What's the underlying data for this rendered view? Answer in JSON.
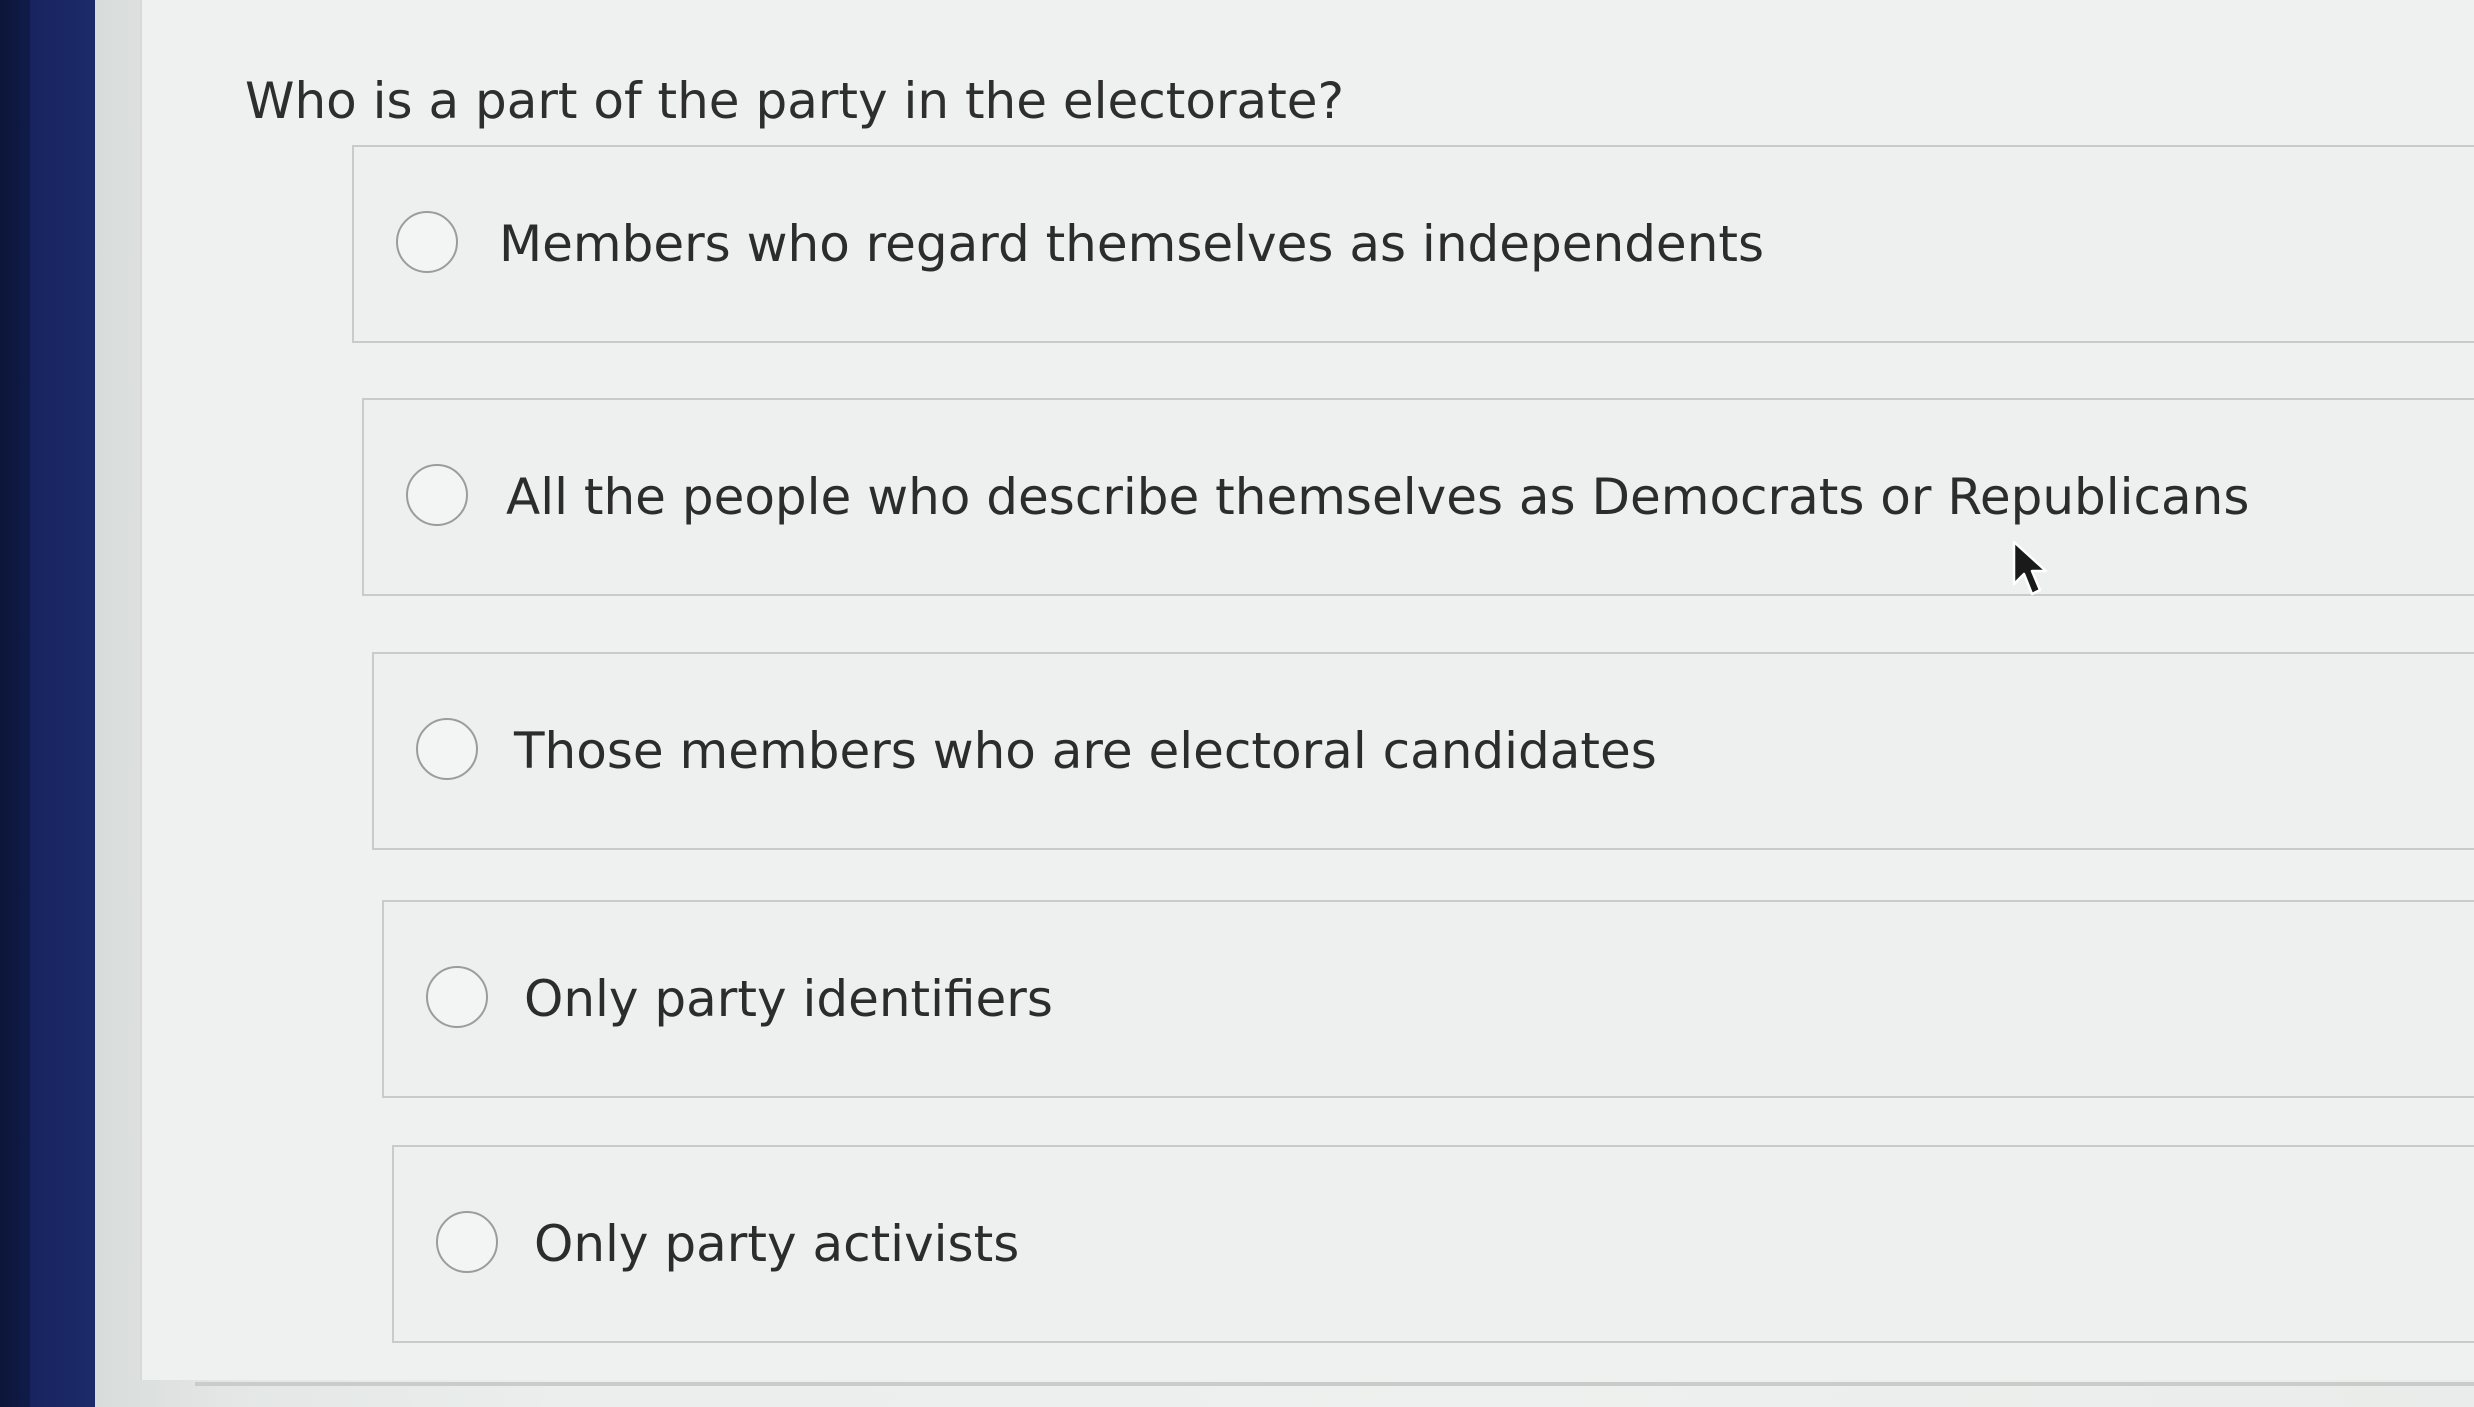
{
  "question": {
    "text": "Who is a part of the party in the electorate?"
  },
  "options": [
    {
      "label": "Members who regard themselves as independents",
      "selected": false
    },
    {
      "label": "All the people who describe themselves as Democrats or Republicans",
      "selected": false
    },
    {
      "label": "Those members who are electoral candidates",
      "selected": false
    },
    {
      "label": "Only party identifiers",
      "selected": false
    },
    {
      "label": "Only party activists",
      "selected": false
    }
  ],
  "colors": {
    "sidebar": "#14205a",
    "background": "#eff1f0",
    "border": "#c8cbca",
    "text": "#2c2c2c"
  },
  "icons": {
    "cursor": "mouse-pointer-icon",
    "radio": "radio-unchecked-icon"
  }
}
